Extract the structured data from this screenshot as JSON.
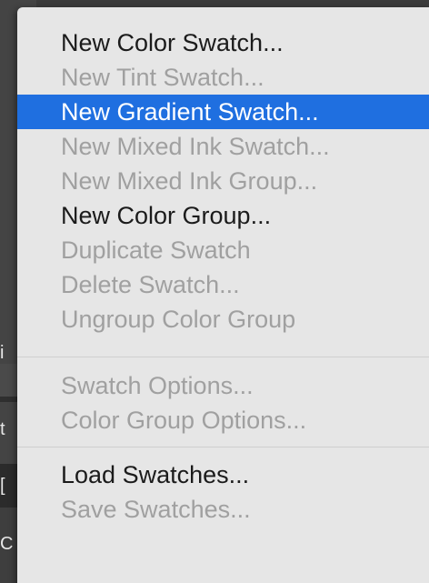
{
  "background_glyphs": [
    "i",
    "t",
    "[",
    "C"
  ],
  "menu": {
    "groups": [
      [
        {
          "label": "New Color Swatch...",
          "enabled": true,
          "highlighted": false
        },
        {
          "label": "New Tint Swatch...",
          "enabled": false,
          "highlighted": false
        },
        {
          "label": "New Gradient Swatch...",
          "enabled": true,
          "highlighted": true
        },
        {
          "label": "New Mixed Ink Swatch...",
          "enabled": false,
          "highlighted": false
        },
        {
          "label": "New Mixed Ink Group...",
          "enabled": false,
          "highlighted": false
        },
        {
          "label": "New Color Group...",
          "enabled": true,
          "highlighted": false
        },
        {
          "label": "Duplicate Swatch",
          "enabled": false,
          "highlighted": false
        },
        {
          "label": "Delete Swatch...",
          "enabled": false,
          "highlighted": false
        },
        {
          "label": "Ungroup Color Group",
          "enabled": false,
          "highlighted": false
        }
      ],
      [
        {
          "label": "Swatch Options...",
          "enabled": false,
          "highlighted": false
        },
        {
          "label": "Color Group Options...",
          "enabled": false,
          "highlighted": false
        }
      ],
      [
        {
          "label": "Load Swatches...",
          "enabled": true,
          "highlighted": false
        },
        {
          "label": "Save Swatches...",
          "enabled": false,
          "highlighted": false
        }
      ]
    ]
  },
  "colors": {
    "highlight": "#1f6fe0",
    "menu_background": "#e6e6e6",
    "enabled_text": "#1b1b1b",
    "disabled_text": "#a0a0a0"
  }
}
